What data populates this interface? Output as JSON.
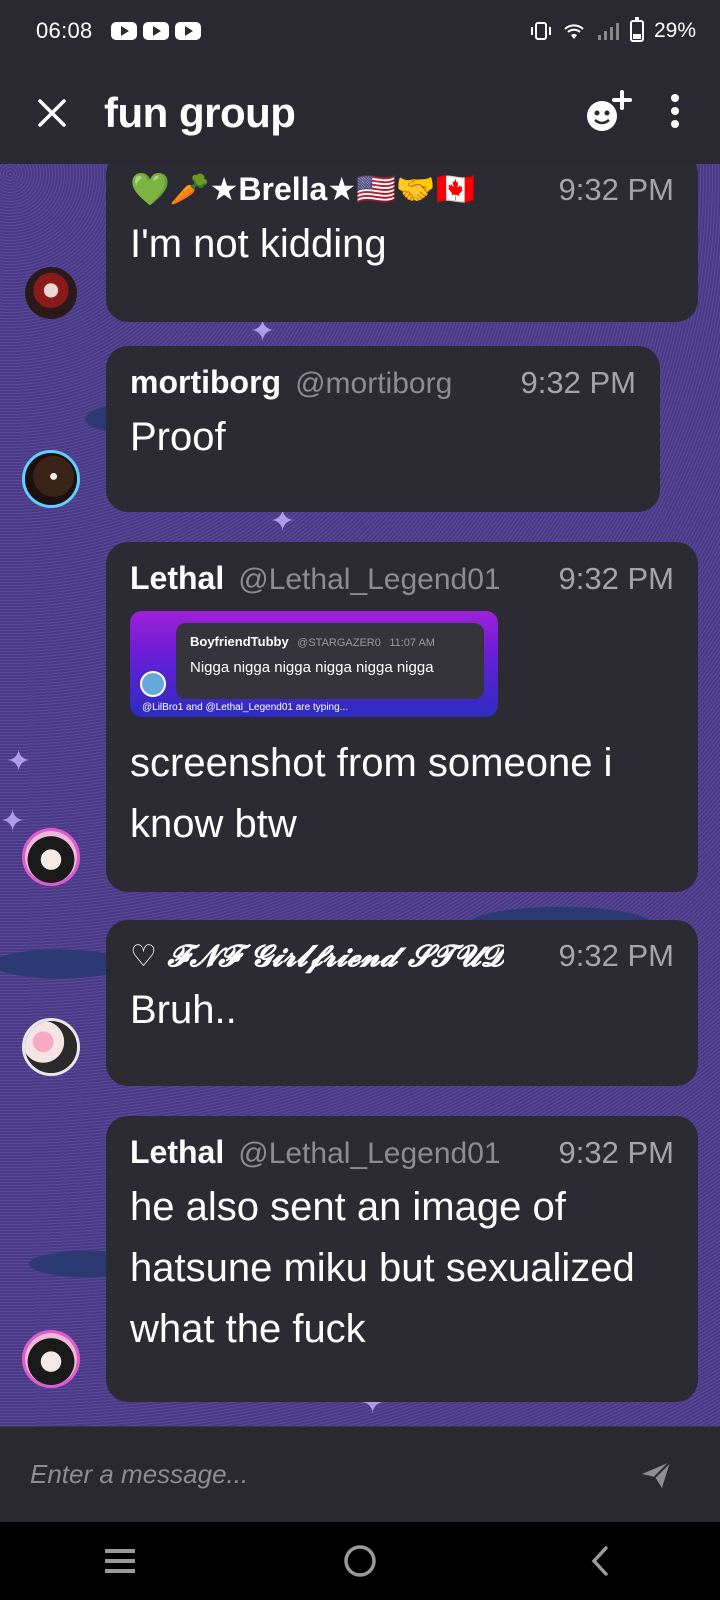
{
  "status_bar": {
    "time": "06:08",
    "battery": "29%",
    "notification_icons": [
      "youtube-icon",
      "youtube-icon",
      "youtube-icon"
    ],
    "system_icons": [
      "vibrate-icon",
      "wifi-icon",
      "signal-icon",
      "battery-icon"
    ]
  },
  "header": {
    "title": "fun group",
    "close_icon": "close-icon",
    "add_member_icon": "add-member-icon",
    "menu_icon": "more-vert-icon"
  },
  "messages": [
    {
      "author": "💚🥕★Brella★🇺🇸🤝🇨🇦",
      "handle": "",
      "time": "9:32 PM",
      "text": "I'm not kidding"
    },
    {
      "author": "mortiborg",
      "handle": "@mortiborg",
      "time": "9:32 PM",
      "text": "Proof"
    },
    {
      "author": "Lethal",
      "handle": "@Lethal_Legend01",
      "time": "9:32 PM",
      "text": "screenshot from someone i know btw",
      "attachment": {
        "user": "BoyfriendTubby",
        "handle": "@STARGAZER0",
        "time": "11:07 AM",
        "text": "Nigga nigga nigga nigga nigga nigga",
        "typing": "@LilBro1 and @Lethal_Legend01 are typing..."
      }
    },
    {
      "author": "♡ 𝓕𝓝𝓕 𝓖𝓲𝓻𝓵𝓯𝓻𝓲𝓮𝓷𝓭 𝓢𝓣𝓤𝓓",
      "handle": "",
      "time": "9:32 PM",
      "text": "Bruh.."
    },
    {
      "author": "Lethal",
      "handle": "@Lethal_Legend01",
      "time": "9:32 PM",
      "text": "he also sent an image of hatsune miku but sexualized what the fuck"
    }
  ],
  "composer": {
    "placeholder": "Enter a message...",
    "send_icon": "send-icon"
  },
  "nav_bar": {
    "icons": [
      "recent-apps-icon",
      "home-icon",
      "back-icon"
    ]
  },
  "colors": {
    "background": "#2a2830",
    "bubble": "#2c2a33",
    "wallpaper": "#4b3b88",
    "timestamp": "#a5a3ad",
    "handle": "#8d8b96"
  }
}
